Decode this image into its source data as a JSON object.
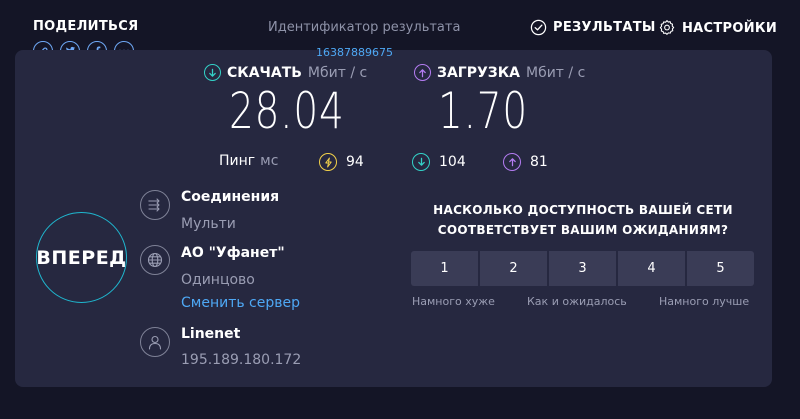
{
  "share": {
    "title": "ПОДЕЛИТЬСЯ",
    "icons": [
      "link-icon",
      "twitter-icon",
      "facebook-icon",
      "more-icon"
    ]
  },
  "result": {
    "label": "Идентификатор результата",
    "id": "16387889675"
  },
  "header": {
    "results": "РЕЗУЛЬТАТЫ",
    "settings": "НАСТРОЙКИ"
  },
  "download": {
    "label": "СКАЧАТЬ",
    "unit": "Мбит / с",
    "value": "28.04"
  },
  "upload": {
    "label": "ЗАГРУЗКА",
    "unit": "Мбит / с",
    "value": "1.70"
  },
  "ping": {
    "label": "Пинг",
    "unit": "мс",
    "idle": "94",
    "download": "104",
    "upload": "81"
  },
  "go_button": "ВПЕРЕД",
  "connections": {
    "title": "Соединения",
    "value": "Мульти"
  },
  "server": {
    "name": "АО \"Уфанет\"",
    "city": "Одинцово",
    "change": "Сменить сервер"
  },
  "provider": {
    "name": "Linenet",
    "ip": "195.189.180.172"
  },
  "survey": {
    "question_line1": "НАСКОЛЬКО ДОСТУПНОСТЬ ВАШЕЙ СЕТИ",
    "question_line2": "СООТВЕТСТВУЕТ ВАШИМ ОЖИДАНИЯМ?",
    "options": [
      "1",
      "2",
      "3",
      "4",
      "5"
    ],
    "low_label": "Намного хуже",
    "mid_label": "Как и ожидалось",
    "high_label": "Намного лучше"
  },
  "colors": {
    "background": "#141526",
    "panel": "#262840",
    "download_accent": "#33d2c8",
    "upload_accent": "#b47cf2",
    "idle_accent": "#f2d14a",
    "link": "#4ea8f5",
    "go_ring": "#1fb7cf"
  }
}
